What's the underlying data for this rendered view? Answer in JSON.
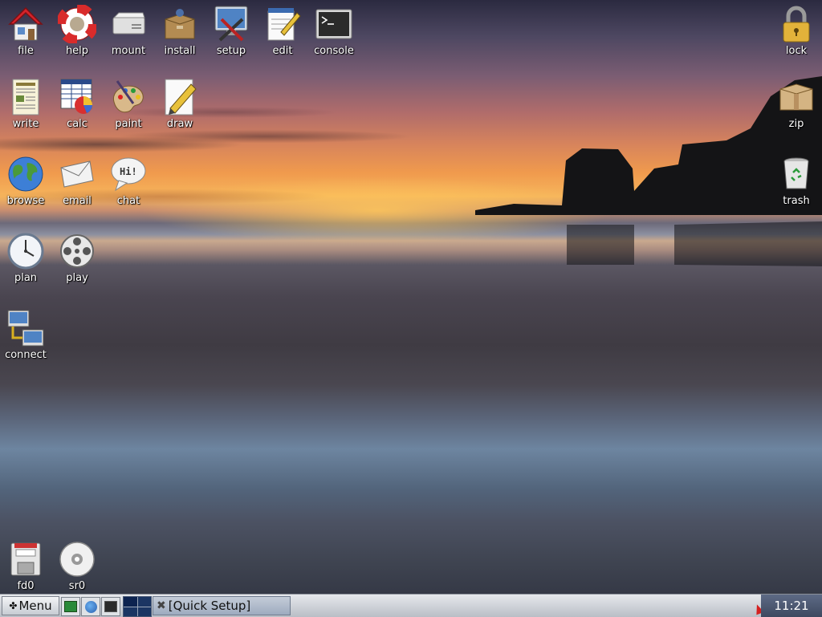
{
  "desktop": {
    "icons": [
      {
        "label": "file"
      },
      {
        "label": "help"
      },
      {
        "label": "mount"
      },
      {
        "label": "install"
      },
      {
        "label": "setup"
      },
      {
        "label": "edit"
      },
      {
        "label": "console"
      },
      {
        "label": "lock"
      },
      {
        "label": "write"
      },
      {
        "label": "calc"
      },
      {
        "label": "paint"
      },
      {
        "label": "draw"
      },
      {
        "label": "zip"
      },
      {
        "label": "browse"
      },
      {
        "label": "email"
      },
      {
        "label": "chat"
      },
      {
        "label": "trash"
      },
      {
        "label": "plan"
      },
      {
        "label": "play"
      },
      {
        "label": "connect"
      },
      {
        "label": "fd0"
      },
      {
        "label": "sr0"
      }
    ]
  },
  "taskbar": {
    "menu_label": "Menu",
    "task_title": "[Quick Setup]",
    "clock": "11:21"
  },
  "colors": {
    "taskbar_bg": "#c9cdd3",
    "clock_bg": "#4a5670",
    "pager_bg": "#1b3563"
  }
}
